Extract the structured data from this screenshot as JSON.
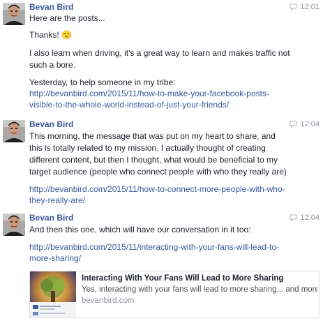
{
  "messages": [
    {
      "sender": "Bevan Bird",
      "time": "12:01",
      "lines": [
        "Here are the posts...",
        "Thanks! 🙂",
        "I also learn when driving, it's a great way to learn and makes traffic not",
        "such a bore.",
        "Yesterday, to help someone in my tribe:",
        "http://bevanbird.com/2015/11/how-to-make-your-facebook-posts-",
        "visible-to-the-whole-world-instead-of-just-your-friends/"
      ]
    },
    {
      "sender": "Bevan Bird",
      "time": "12:04",
      "lines": [
        "This morning, the message that was put on my heart to share, and",
        "this is totally related to my mission. I actually thought of creating",
        "different content, but then I thought, what would be beneficial to my",
        "target audience (people who connect people with who they really are)",
        "http://bevanbird.com/2015/11/how-to-connect-more-people-with-who-",
        "they-really-are/"
      ]
    },
    {
      "sender": "Bevan Bird",
      "time": "12:04",
      "lines": [
        "And then this one, which will have our conversation in it too:",
        "http://bevanbird.com/2015/11/interacting-with-your-fans-will-lead-to-",
        "more-sharing/"
      ],
      "preview": {
        "title": "Interacting With Your Fans Will Lead to More Sharing",
        "description": "Yes, interacting with your fans will lead to more sharing... and more pe...",
        "domain": "bevanbird.com"
      }
    }
  ],
  "icons": {
    "avatar": "avatar",
    "reply": "speech-bubble-icon"
  },
  "colors": {
    "sender": "#3b5998",
    "link": "#365899",
    "text": "#1d2129",
    "meta": "#90949c"
  }
}
